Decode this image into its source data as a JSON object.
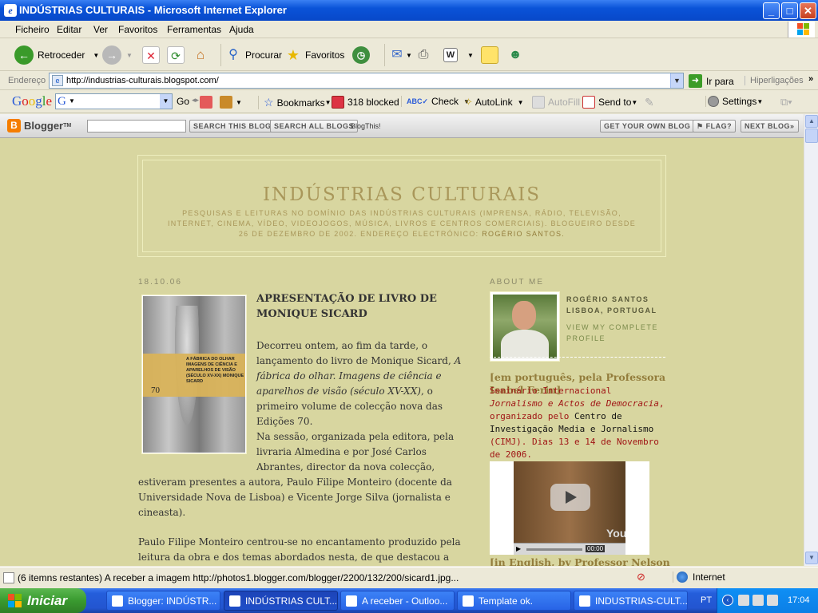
{
  "window": {
    "title": "INDÚSTRIAS CULTURAIS - Microsoft Internet Explorer",
    "minimize": "_",
    "maximize": "□",
    "close": "✕"
  },
  "menu": [
    "Ficheiro",
    "Editar",
    "Ver",
    "Favoritos",
    "Ferramentas",
    "Ajuda"
  ],
  "toolbar": {
    "back": "Retroceder",
    "search": "Procurar",
    "favorites": "Favoritos"
  },
  "address": {
    "label": "Endereço",
    "url": "http://industrias-culturais.blogspot.com/",
    "go": "Ir para",
    "links": "Hiperligações"
  },
  "google_toolbar": {
    "go": "Go",
    "bookmarks": "Bookmarks",
    "blocked": "318 blocked",
    "check": "Check",
    "autolink": "AutoLink",
    "autofill": "AutoFill",
    "sendto": "Send to",
    "settings": "Settings"
  },
  "blogger_nav": {
    "logo": "Blogger",
    "search_blog": "SEARCH THIS BLOG",
    "search_all": "SEARCH ALL BLOGS",
    "blogthis": "BlogThis!",
    "get_own": "GET YOUR OWN BLOG",
    "flag": "FLAG?",
    "next_blog": "NEXT BLOG»"
  },
  "blog": {
    "title": "INDÚSTRIAS CULTURAIS",
    "description": "PESQUISAS E LEITURAS NO DOMÍNIO DAS INDÚSTRIAS CULTURAIS (IMPRENSA, RÁDIO, TELEVISÃO, INTERNET, CINEMA, VÍDEO, VIDEOJOGOS, MÚSICA, LIVROS E CENTROS COMERCIAIS). BLOGUEIRO DESDE 26 DE DEZEMBRO DE 2002. ENDEREÇO ELECTRÓNICO: ",
    "author_link": "ROGÉRIO SANTOS.",
    "post_date": "18.10.06",
    "post_title": "APRESENTAÇÃO DE LIVRO DE MONIQUE SICARD",
    "book_caption": "A FÁBRICA DO OLHAR IMAGENS DE CIÊNCIA E APARELHOS DE VISÃO (SÉCULO XV-XX) MONIQUE SICARD",
    "book_number": "70",
    "p1_a": "Decorreu ontem, ao fim da tarde, o lançamento do livro de Monique Sicard, ",
    "p1_em": "A fábrica do olhar. Imagens de ciência e aparelhos de visão (século XV-XX)",
    "p1_b": ", o primeiro volume de colecção nova das Edições 70.",
    "p2": "Na sessão, organizada pela editora, pela livraria Almedina e por José Carlos Abrantes, director da nova colecção, estiveram presentes a autora, Paulo Filipe Monteiro (docente da Universidade Nova de Lisboa) e Vicente Jorge Silva (jornalista e cineasta).",
    "p3": "Paulo Filipe Monteiro centrou-se no encantamento produzido pela leitura da obra e dos temas abordados nesta, de que destacou a"
  },
  "sidebar": {
    "about_label": "ABOUT ME",
    "name": "ROGÉRIO SANTOS",
    "location": "LISBOA, PORTUGAL",
    "profile_link": "VIEW MY COMPLETE PROFILE",
    "head1": "[em português, pela Professora Isabel Ferin]",
    "body_a": " Seminário Internacional ",
    "body_em": "Jornalismo e Actos de Democracia",
    "body_b": ", organizado pelo ",
    "body_blk": "Centro de Investigação Media e Jornalismo",
    "body_c": " (CIMJ). Dias 13 e 14 de Novembro de 2006.",
    "video_brand": "YouTube",
    "video_time": "00:00",
    "head2": "[in English, by Professor Nelson"
  },
  "status": {
    "text": "(6 itemns restantes) A receber a imagem http://photos1.blogger.com/blogger/2200/132/200/sicard1.jpg...",
    "zone": "Internet"
  },
  "taskbar": {
    "start": "Iniciar",
    "tasks": [
      "Blogger: INDÚSTR...",
      "INDÚSTRIAS CULT...",
      "A receber - Outloo...",
      "Template ok.",
      "INDUSTRIAS-CULT..."
    ],
    "lang": "PT",
    "clock": "17:04"
  }
}
